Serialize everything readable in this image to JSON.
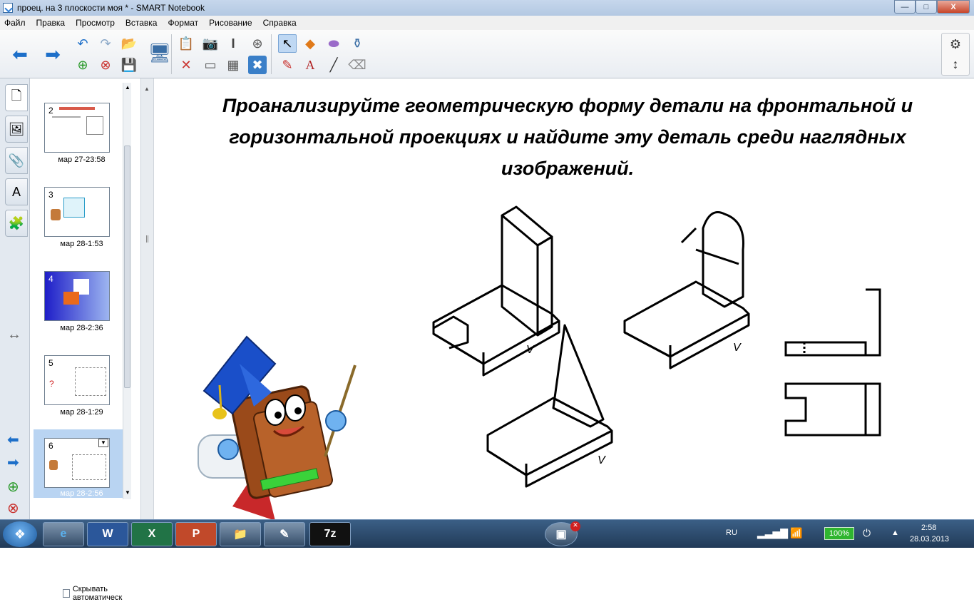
{
  "window": {
    "title": "проец. на 3 плоскости моя * - SMART Notebook",
    "min_label": "—",
    "max_label": "□",
    "close_label": "X"
  },
  "menu": [
    "Файл",
    "Правка",
    "Просмотр",
    "Вставка",
    "Формат",
    "Рисование",
    "Справка"
  ],
  "slides": [
    {
      "num": "2",
      "label": "мар 27-23:58"
    },
    {
      "num": "3",
      "label": "мар 28-1:53"
    },
    {
      "num": "4",
      "label": "мар 28-2:36"
    },
    {
      "num": "5",
      "label": "мар 28-1:29"
    },
    {
      "num": "6",
      "label": "мар 28-2:56"
    }
  ],
  "autohide_label": "Скрывать автоматическ",
  "canvas": {
    "heading": "Проанализируйте геометрическую форму детали на фронтальной  и горизонтальной проекциях и  найдите эту деталь среди наглядных изображений.",
    "view_labels": [
      "V",
      "V",
      "V"
    ]
  },
  "tray": {
    "lang": "RU",
    "battery": "100%",
    "time": "2:58",
    "date": "28.03.2013"
  },
  "taskbar_items": [
    "e",
    "W",
    "X",
    "P",
    "folder",
    "notebook",
    "7z",
    "smart-board"
  ],
  "colors": {
    "accent": "#2f7fd7",
    "taskbar": "#2a476b",
    "selection": "#b9d4f2"
  }
}
